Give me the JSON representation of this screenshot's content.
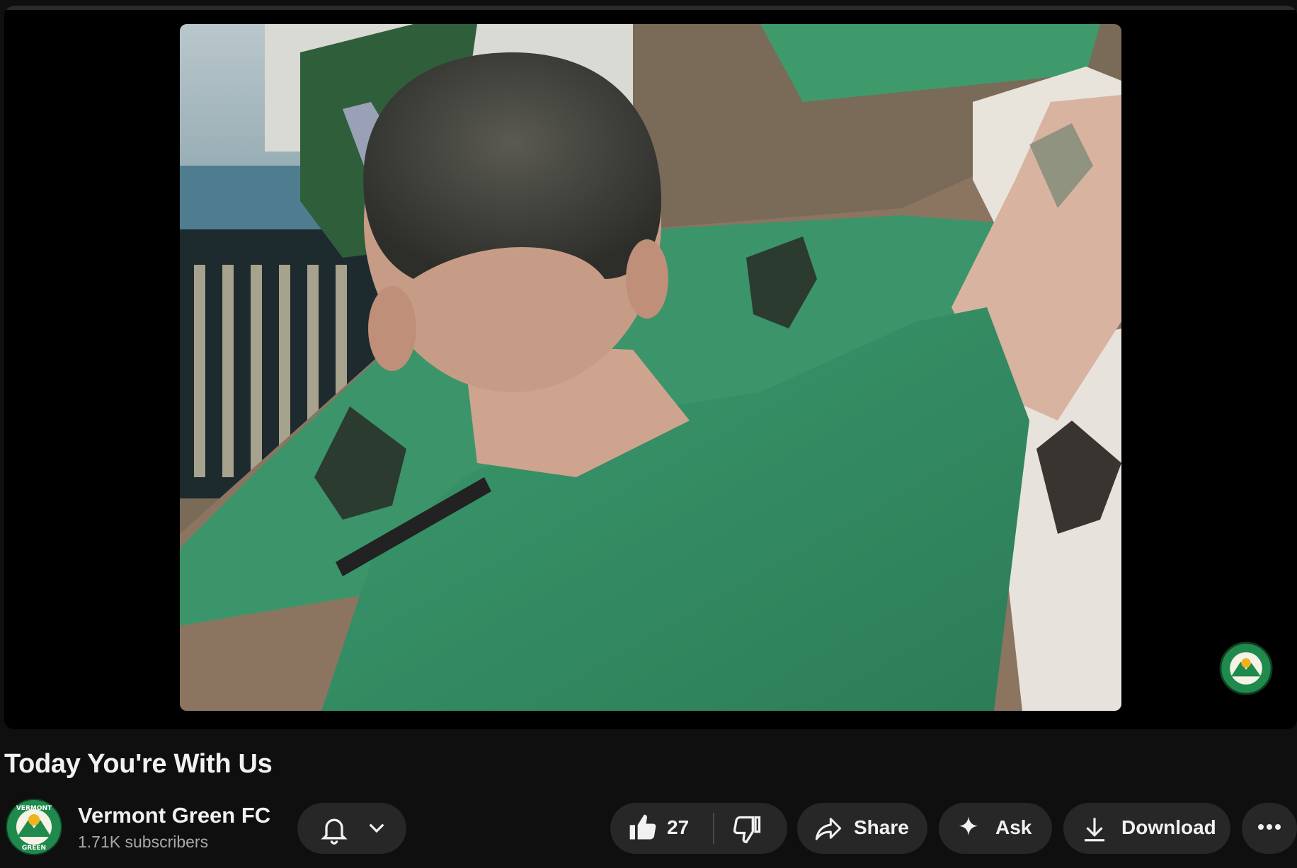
{
  "video": {
    "title": "Today You're With Us"
  },
  "channel": {
    "name": "Vermont Green FC",
    "subscribers": "1.71K subscribers",
    "logo_text_top": "VERMONT",
    "logo_text_bottom": "GREEN"
  },
  "actions": {
    "like_count": "27",
    "share_label": "Share",
    "ask_label": "Ask",
    "download_label": "Download"
  },
  "icons": {
    "subscribe": "bell-icon",
    "subscribe_menu": "chevron-down-icon",
    "like": "thumbs-up-icon",
    "dislike": "thumbs-down-icon",
    "share": "share-arrow-icon",
    "ask": "sparkle-icon",
    "download": "download-icon",
    "more": "more-horizontal-icon"
  },
  "colors": {
    "background": "#0f0f0f",
    "pill": "#272727",
    "brand_green": "#1f8a4c",
    "text": "#f1f1f1",
    "muted": "#aaaaaa"
  }
}
